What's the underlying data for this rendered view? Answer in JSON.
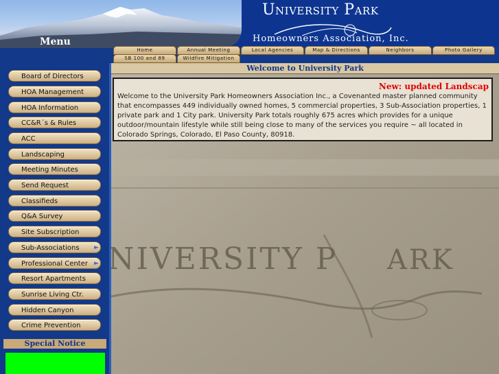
{
  "header": {
    "title": "University Park",
    "subtitle": "Homeowners Association, Inc.",
    "menu_label": "Menu"
  },
  "top_nav": {
    "row1": [
      "Home",
      "Annual Meeting",
      "Local Agencies",
      "Map & Directions",
      "Neighbors",
      "Photo Gallery"
    ],
    "row2": [
      "SB 100 and 89",
      "Wildfire Mitigation"
    ]
  },
  "sidebar": {
    "items": [
      {
        "label": "Board of Directors",
        "submenu": false
      },
      {
        "label": "HOA Management",
        "submenu": false
      },
      {
        "label": "HOA Information",
        "submenu": false
      },
      {
        "label": "CC&R´s & Rules",
        "submenu": false
      },
      {
        "label": "ACC",
        "submenu": false
      },
      {
        "label": "Landscaping",
        "submenu": false
      },
      {
        "label": "Meeting Minutes",
        "submenu": false
      },
      {
        "label": "Send Request",
        "submenu": false
      },
      {
        "label": "Classifieds",
        "submenu": false
      },
      {
        "label": "Q&A Survey",
        "submenu": false
      },
      {
        "label": "Site Subscription",
        "submenu": false
      },
      {
        "label": "Sub-Associations",
        "submenu": true
      },
      {
        "label": "Professional Center",
        "submenu": true
      },
      {
        "label": "Resort Apartments",
        "submenu": false
      },
      {
        "label": "Sunrise Living Ctr.",
        "submenu": false
      },
      {
        "label": "Hidden Canyon",
        "submenu": false
      },
      {
        "label": "Crime Prevention",
        "submenu": false
      }
    ],
    "special_notice_title": "Special Notice"
  },
  "main": {
    "welcome_title": "Welcome to University Park",
    "marquee_text": "New: updated Landscap",
    "welcome_text": "Welcome to the University Park Homeowners Association Inc., a Covenanted master planned community that encompasses 449 individually owned homes, 5 commercial properties, 3 Sub-Association properties, 1 private park and 1 City park.  University Park totals roughly 675 acres which provides for a unique outdoor/mountain lifestyle while still being close to many of the services you require ~ all located in Colorado Springs, Colorado, El Paso County, 80918."
  },
  "colors": {
    "page_blue": "#12398a",
    "button_tan": "#d9c19a",
    "marquee_red": "#e00000",
    "notice_green": "#00ff00"
  }
}
